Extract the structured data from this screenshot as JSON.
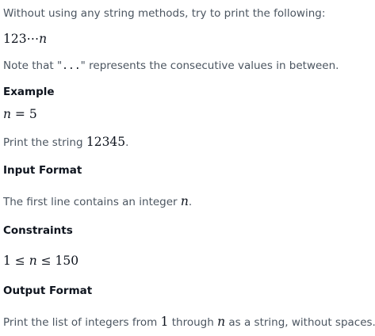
{
  "intro": {
    "text": "Without using any string methods, try to print the following:"
  },
  "pattern": {
    "digits": "123",
    "dots": "⋯",
    "var": "n"
  },
  "note": {
    "prefix": "Note that \"",
    "code": "...",
    "suffix": "\" represents the consecutive values in between."
  },
  "example": {
    "heading": "Example",
    "var": "n",
    "eq": " = 5",
    "print_prefix": "Print the string ",
    "print_value": "12345",
    "print_suffix": "."
  },
  "input_format": {
    "heading": "Input Format",
    "text": "The first line contains an integer ",
    "var": "n",
    "suffix": "."
  },
  "constraints": {
    "heading": "Constraints",
    "lower": "1 ≤ ",
    "var": "n",
    "upper": " ≤ 150"
  },
  "output_format": {
    "heading": "Output Format",
    "text_1": "Print the list of integers from ",
    "from_value": "1",
    "text_2": " through ",
    "var": "n",
    "text_3": " as a string, without spaces."
  }
}
